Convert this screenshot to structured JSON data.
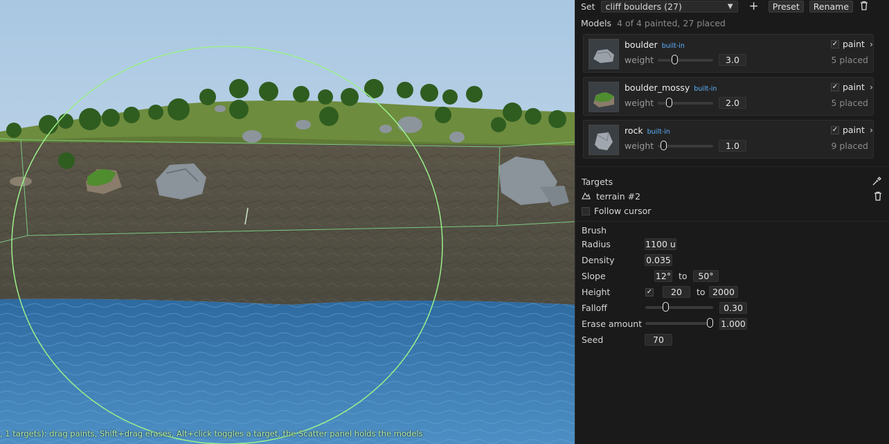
{
  "viewport": {
    "hint_text": ", 1 targets): drag paints, Shift+drag erases, Alt+click toggles a target, the Scatter panel holds the models"
  },
  "panel": {
    "set": {
      "label": "Set",
      "value": "cliff boulders (27)",
      "add_icon": "plus-icon",
      "preset_label": "Preset",
      "rename_label": "Rename",
      "delete_icon": "trash-icon"
    },
    "models": {
      "title": "Models",
      "summary": "4 of 4 painted, 27 placed",
      "weight_label": "weight",
      "paint_label": "paint",
      "items": [
        {
          "name": "boulder",
          "badge": "built-in",
          "weight": "3.0",
          "weight_fraction": 0.3,
          "paint": true,
          "placed": "5 placed"
        },
        {
          "name": "boulder_mossy",
          "badge": "built-in",
          "weight": "2.0",
          "weight_fraction": 0.2,
          "paint": true,
          "placed": "5 placed"
        },
        {
          "name": "rock",
          "badge": "built-in",
          "weight": "1.0",
          "weight_fraction": 0.1,
          "paint": true,
          "placed": "9 placed"
        }
      ]
    },
    "targets": {
      "title": "Targets",
      "picker_icon": "eyedropper-icon",
      "target_icon": "terrain-icon",
      "target_name": "terrain #2",
      "remove_icon": "trash-icon",
      "follow_cursor_label": "Follow cursor",
      "follow_cursor_checked": false
    },
    "brush": {
      "title": "Brush",
      "radius_label": "Radius",
      "radius_value": "1100 u",
      "density_label": "Density",
      "density_value": "0.035",
      "slope_label": "Slope",
      "slope_min": "12°",
      "slope_to": "to",
      "slope_max": "50°",
      "height_label": "Height",
      "height_enabled": true,
      "height_min": "20",
      "height_to": "to",
      "height_max": "2000",
      "falloff_label": "Falloff",
      "falloff_value": "0.30",
      "falloff_fraction": 0.3,
      "erase_label": "Erase amount",
      "erase_value": "1.000",
      "erase_fraction": 1.0,
      "seed_label": "Seed",
      "seed_value": "70"
    }
  },
  "colors": {
    "panel_bg": "#1a1a1a",
    "accent_badge": "#5fb2ff",
    "brush_ring": "#9bf08a",
    "water": "#2e6aa0",
    "sky": "#a9c7e2"
  }
}
